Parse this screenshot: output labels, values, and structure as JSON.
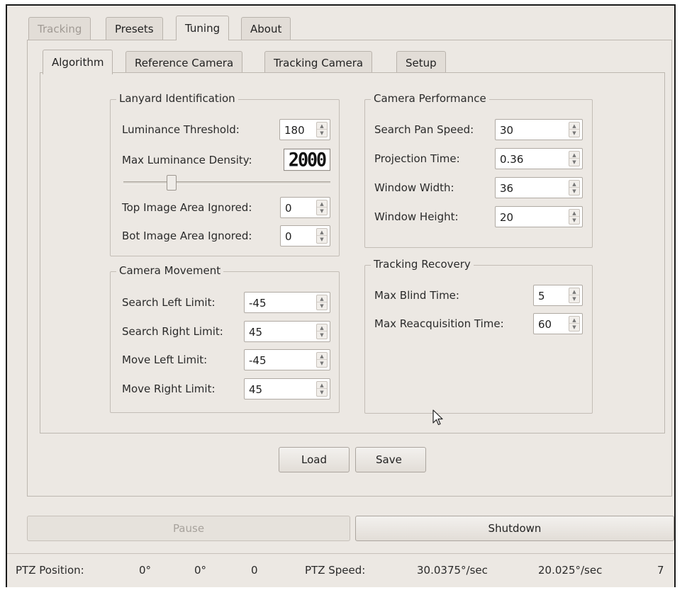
{
  "top_tabs": [
    {
      "label": "Tracking",
      "state": "disabled"
    },
    {
      "label": "Presets",
      "state": "normal"
    },
    {
      "label": "Tuning",
      "state": "active"
    },
    {
      "label": "About",
      "state": "normal"
    }
  ],
  "sub_tabs": [
    {
      "label": "Algorithm",
      "state": "active"
    },
    {
      "label": "Reference Camera",
      "state": "normal"
    },
    {
      "label": "Tracking Camera",
      "state": "normal"
    },
    {
      "label": "Setup",
      "state": "normal"
    }
  ],
  "lanyard": {
    "title": "Lanyard Identification",
    "luminance_threshold_label": "Luminance Threshold:",
    "luminance_threshold_value": "180",
    "max_luminance_density_label": "Max Luminance Density:",
    "max_luminance_density_value": "2000",
    "density_slider_fraction": 0.22,
    "top_area_label": "Top Image Area Ignored:",
    "top_area_value": "0",
    "bot_area_label": "Bot Image Area Ignored:",
    "bot_area_value": "0"
  },
  "movement": {
    "title": "Camera Movement",
    "search_left_label": "Search Left Limit:",
    "search_left_value": "-45",
    "search_right_label": "Search Right Limit:",
    "search_right_value": "45",
    "move_left_label": "Move Left Limit:",
    "move_left_value": "-45",
    "move_right_label": "Move Right Limit:",
    "move_right_value": "45"
  },
  "performance": {
    "title": "Camera Performance",
    "pan_speed_label": "Search Pan Speed:",
    "pan_speed_value": "30",
    "projection_label": "Projection Time:",
    "projection_value": "0.36",
    "width_label": "Window Width:",
    "width_value": "36",
    "height_label": "Window Height:",
    "height_value": "20"
  },
  "recovery": {
    "title": "Tracking Recovery",
    "blind_label": "Max Blind Time:",
    "blind_value": "5",
    "reacq_label": "Max Reacquisition Time:",
    "reacq_value": "60"
  },
  "buttons": {
    "load": "Load",
    "save": "Save",
    "pause": "Pause",
    "shutdown": "Shutdown"
  },
  "status": {
    "position_label": "PTZ Position:",
    "pos_pan": "0°",
    "pos_tilt": "0°",
    "pos_zoom": "0",
    "speed_label": "PTZ Speed:",
    "speed_pan": "30.0375°/sec",
    "speed_tilt": "20.025°/sec",
    "speed_zoom": "7"
  }
}
